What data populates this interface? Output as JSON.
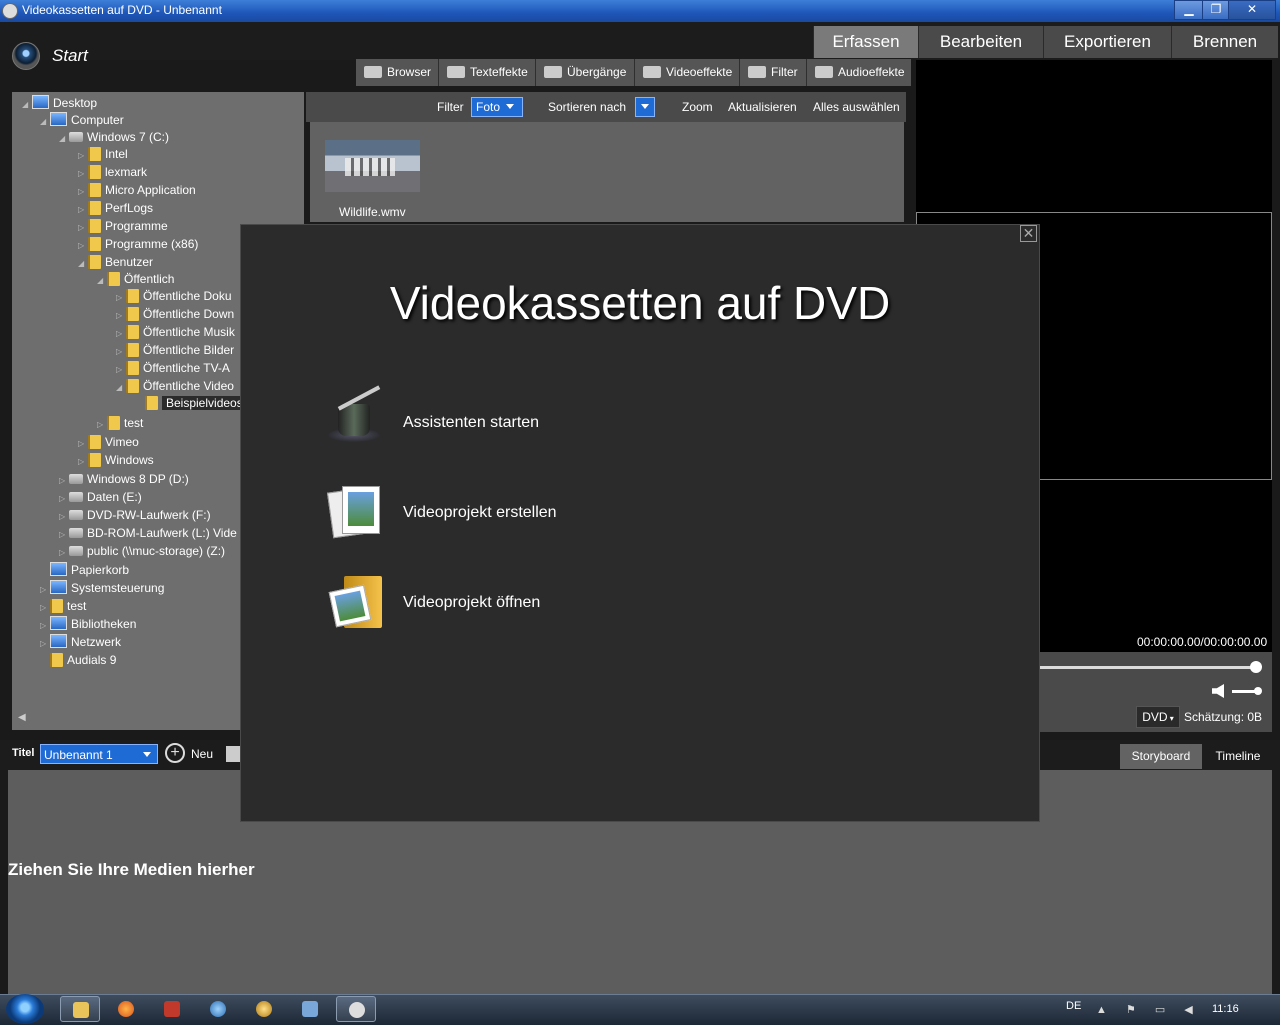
{
  "window": {
    "title": "Videokassetten auf DVD - Unbenannt",
    "min_glyph": "▁",
    "max_glyph": "❐",
    "close_glyph": "✕"
  },
  "header": {
    "start_label": "Start",
    "tabs": [
      "Erfassen",
      "Bearbeiten",
      "Exportieren",
      "Brennen"
    ]
  },
  "toolbar": {
    "buttons": [
      {
        "label": "Browser",
        "icon": "folder-icon"
      },
      {
        "label": "Texteffekte",
        "icon": "keyboard-icon"
      },
      {
        "label": "Übergänge",
        "icon": "transition-icon"
      },
      {
        "label": "Videoeffekte",
        "icon": "clapper-icon"
      },
      {
        "label": "Filter",
        "icon": "filter-icon"
      },
      {
        "label": "Audioeffekte",
        "icon": "headphones-icon"
      }
    ]
  },
  "tree": {
    "items": [
      {
        "label": "Desktop",
        "icon": "desktop"
      },
      {
        "label": "Computer",
        "icon": "computer"
      },
      {
        "label": "Windows 7 (C:)",
        "icon": "drive"
      },
      {
        "label": "Intel",
        "icon": "folder"
      },
      {
        "label": "lexmark",
        "icon": "folder"
      },
      {
        "label": "Micro Application",
        "icon": "folder"
      },
      {
        "label": "PerfLogs",
        "icon": "folder"
      },
      {
        "label": "Programme",
        "icon": "folder"
      },
      {
        "label": "Programme (x86)",
        "icon": "folder"
      },
      {
        "label": "Benutzer",
        "icon": "folder"
      },
      {
        "label": "Öffentlich",
        "icon": "folder"
      },
      {
        "label": "Öffentliche Doku",
        "icon": "folder"
      },
      {
        "label": "Öffentliche Down",
        "icon": "folder"
      },
      {
        "label": "Öffentliche Musik",
        "icon": "folder"
      },
      {
        "label": "Öffentliche Bilder",
        "icon": "folder"
      },
      {
        "label": "Öffentliche TV-A",
        "icon": "folder"
      },
      {
        "label": "Öffentliche Video",
        "icon": "folder"
      },
      {
        "label": "Beispielvideos",
        "icon": "folder"
      },
      {
        "label": "test",
        "icon": "folder"
      },
      {
        "label": "Vimeo",
        "icon": "folder"
      },
      {
        "label": "Windows",
        "icon": "folder"
      },
      {
        "label": "Windows 8 DP (D:)",
        "icon": "drive"
      },
      {
        "label": "Daten (E:)",
        "icon": "drive"
      },
      {
        "label": "DVD-RW-Laufwerk (F:)",
        "icon": "drive"
      },
      {
        "label": "BD-ROM-Laufwerk (L:) Vide",
        "icon": "drive"
      },
      {
        "label": "public (\\\\muc-storage) (Z:)",
        "icon": "drive"
      },
      {
        "label": "Papierkorb",
        "icon": "computer"
      },
      {
        "label": "Systemsteuerung",
        "icon": "computer"
      },
      {
        "label": "test",
        "icon": "folder"
      },
      {
        "label": "Bibliotheken",
        "icon": "computer"
      },
      {
        "label": "Netzwerk",
        "icon": "computer"
      },
      {
        "label": "Audials 9",
        "icon": "folder"
      }
    ]
  },
  "media": {
    "filter_label": "Filter",
    "filter_value": "Foto",
    "sort_label": "Sortieren nach",
    "zoom_label": "Zoom",
    "refresh_label": "Aktualisieren",
    "select_all_label": "Alles auswählen",
    "file_name": "Wildlife.wmv"
  },
  "preview": {
    "timecode": "00:00:00.00/00:00:00.00",
    "format": "DVD",
    "estimate": "Schätzung: 0B"
  },
  "project": {
    "title_label": "Titel",
    "title_value": "Unbenannt 1",
    "new_label": "Neu",
    "storyboard_tab": "Storyboard",
    "timeline_tab": "Timeline",
    "drop_hint": "Ziehen Sie Ihre Medien hierher"
  },
  "modal": {
    "title": "Videokassetten auf DVD",
    "close_glyph": "✕",
    "options": [
      {
        "label": "Assistenten starten",
        "icon": "magic-hat-icon"
      },
      {
        "label": "Videoprojekt erstellen",
        "icon": "photos-icon"
      },
      {
        "label": "Videoprojekt öffnen",
        "icon": "open-folder-icon"
      }
    ]
  },
  "taskbar": {
    "language": "DE",
    "time": "11:16",
    "tray_glyphs": "▲ ⚑ ▭ ◀"
  }
}
